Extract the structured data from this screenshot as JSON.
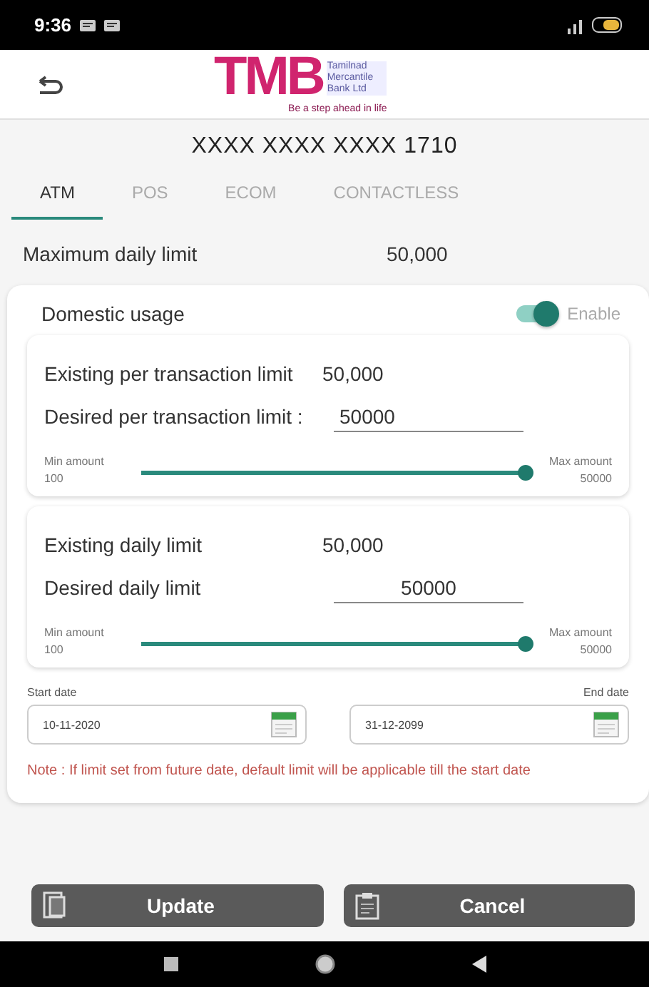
{
  "status_bar": {
    "time": "9:36"
  },
  "header": {
    "logo_text": "TMB",
    "bank_name": "Tamilnad Mercantile Bank Ltd",
    "tagline": "Be a step ahead in life"
  },
  "card_number": "XXXX XXXX XXXX 1710",
  "tabs": [
    {
      "label": "ATM",
      "selected": true
    },
    {
      "label": "POS",
      "selected": false
    },
    {
      "label": "ECOM",
      "selected": false
    },
    {
      "label": "CONTACTLESS",
      "selected": false
    }
  ],
  "max_daily_limit": {
    "label": "Maximum daily limit",
    "value": "50,000"
  },
  "domestic_usage": {
    "label": "Domestic usage",
    "on": true,
    "toggle_label": "Enable"
  },
  "limit_cards": [
    {
      "existing_label": "Existing per transaction limit",
      "existing_value": "50,000",
      "desired_label": "Desired per transaction limit :",
      "desired_value": "50000",
      "slider": {
        "min_label": "Min amount",
        "min_value": "100",
        "max_label": "Max amount",
        "max_value": "50000",
        "level": 1
      }
    },
    {
      "existing_label": "Existing daily limit",
      "existing_value": "50,000",
      "desired_label": "Desired daily limit",
      "desired_value": "50000",
      "slider": {
        "min_label": "Min amount",
        "min_value": "100",
        "max_label": "Max amount",
        "max_value": "50000",
        "level": 1
      }
    }
  ],
  "dates": [
    {
      "label": "Start date",
      "value": "10-11-2020"
    },
    {
      "label": "End date",
      "value": "31-12-2099"
    }
  ],
  "note": "Note : If limit set from future date, default limit will be applicable till the start date",
  "buttons": [
    {
      "label": "Update",
      "kind": "update"
    },
    {
      "label": "Cancel",
      "kind": "cancel"
    }
  ]
}
